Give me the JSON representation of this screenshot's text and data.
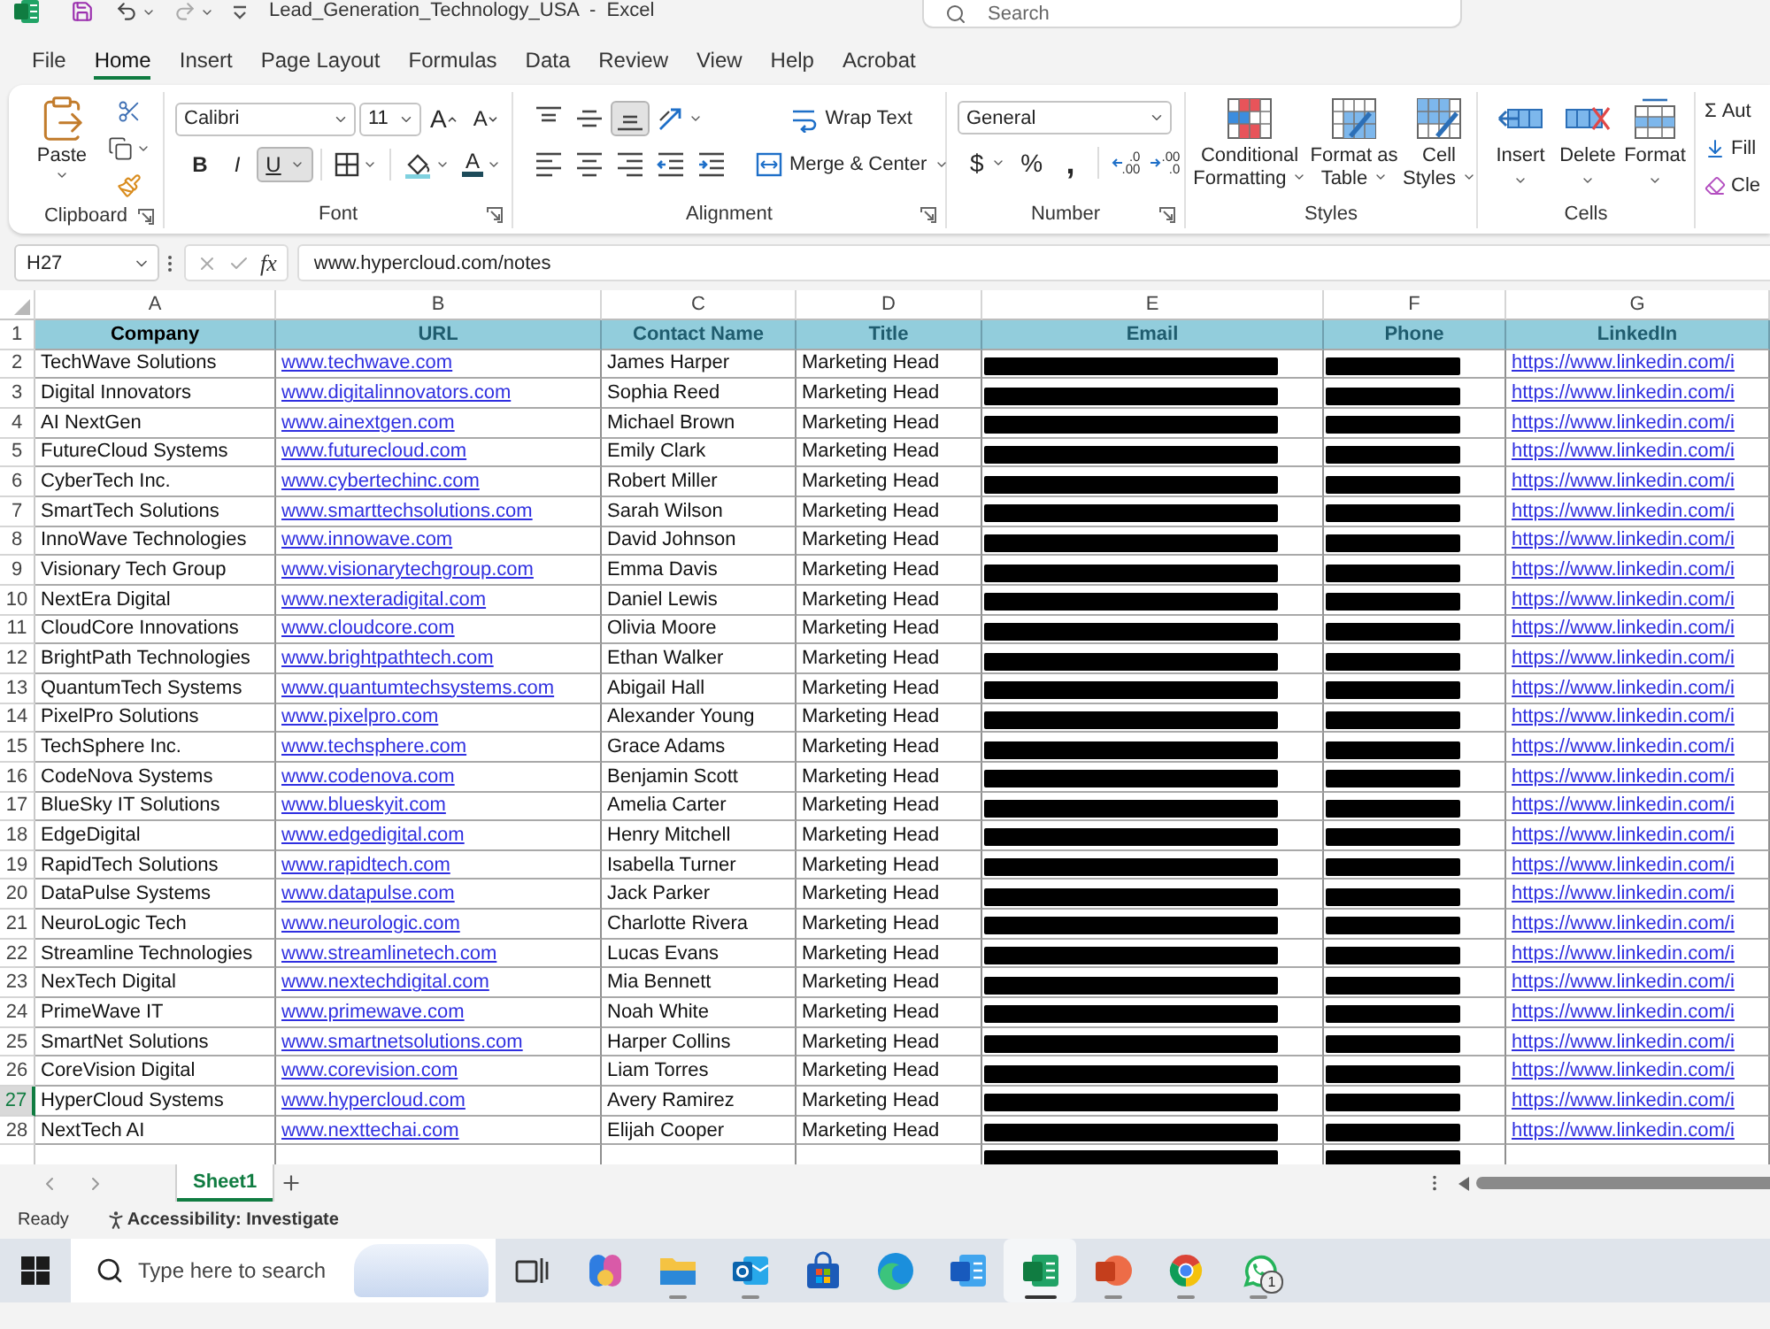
{
  "title_bar": {
    "title": "Lead_Generation_Technology_USA  -  Excel",
    "search_placeholder": "Search"
  },
  "menu_tabs": [
    {
      "label": "File",
      "selected": false
    },
    {
      "label": "Home",
      "selected": true
    },
    {
      "label": "Insert",
      "selected": false
    },
    {
      "label": "Page Layout",
      "selected": false
    },
    {
      "label": "Formulas",
      "selected": false
    },
    {
      "label": "Data",
      "selected": false
    },
    {
      "label": "Review",
      "selected": false
    },
    {
      "label": "View",
      "selected": false
    },
    {
      "label": "Help",
      "selected": false
    },
    {
      "label": "Acrobat",
      "selected": false
    }
  ],
  "ribbon": {
    "clipboard": {
      "label": "Clipboard",
      "paste": "Paste"
    },
    "font": {
      "label": "Font",
      "font_name": "Calibri",
      "font_size": "11",
      "grow_glyph": "A",
      "shrink_glyph": "A",
      "bold": {
        "glyph": "B",
        "selected": false
      },
      "italic": {
        "glyph": "I",
        "selected": false
      },
      "underline": {
        "glyph": "U",
        "selected": true
      },
      "font_color_glyph": "A"
    },
    "alignment": {
      "label": "Alignment",
      "vertical": [
        {
          "kind": "top",
          "selected": false
        },
        {
          "kind": "middle",
          "selected": false
        },
        {
          "kind": "bottom",
          "selected": true
        }
      ],
      "horizontal": [
        {
          "kind": "left",
          "selected": false
        },
        {
          "kind": "center",
          "selected": false
        },
        {
          "kind": "right",
          "selected": false
        }
      ],
      "wrap_text": "Wrap Text",
      "merge_center": "Merge & Center"
    },
    "number": {
      "label": "Number",
      "format": "General",
      "currency": "$",
      "percent": "%",
      "comma": ",",
      "decimals": [
        {
          "kind": "increase",
          "lines": [
            ".0",
            ".00"
          ]
        },
        {
          "kind": "decrease",
          "lines": [
            ".00",
            ".0"
          ]
        }
      ]
    },
    "styles": {
      "label": "Styles",
      "buttons": [
        {
          "kind": "conditional",
          "lines": [
            "Conditional",
            "Formatting"
          ]
        },
        {
          "kind": "table",
          "lines": [
            "Format as",
            "Table"
          ]
        },
        {
          "kind": "cell_styles",
          "lines": [
            "Cell",
            "Styles"
          ]
        }
      ]
    },
    "cells": {
      "label": "Cells",
      "buttons": [
        {
          "kind": "insert",
          "label": "Insert"
        },
        {
          "kind": "delete",
          "label": "Delete"
        },
        {
          "kind": "format",
          "label": "Format"
        }
      ]
    },
    "editing": {
      "items": [
        {
          "kind": "sum",
          "glyph": "Σ",
          "label": "Aut"
        },
        {
          "kind": "fill",
          "label": "Fill"
        },
        {
          "kind": "clear",
          "label": "Cle"
        }
      ]
    }
  },
  "formula_bar": {
    "name_box": "H27",
    "function_glyph": "fx",
    "formula": "www.hypercloud.com/notes"
  },
  "sheet": {
    "columns": [
      {
        "letter": "A",
        "heading": "Company",
        "kind": "text"
      },
      {
        "letter": "B",
        "heading": "URL",
        "kind": "link"
      },
      {
        "letter": "C",
        "heading": "Contact Name",
        "kind": "text"
      },
      {
        "letter": "D",
        "heading": "Title",
        "kind": "text"
      },
      {
        "letter": "E",
        "heading": "Email",
        "kind": "redacted"
      },
      {
        "letter": "F",
        "heading": "Phone",
        "kind": "redacted"
      },
      {
        "letter": "G",
        "heading": "LinkedIn",
        "kind": "link"
      }
    ],
    "header_row": "1",
    "rows": [
      {
        "number": "2",
        "cells": [
          "TechWave Solutions",
          "www.techwave.com",
          "James Harper",
          "Marketing Head",
          "https://www.linkedin.com/i"
        ],
        "selected": false
      },
      {
        "number": "3",
        "cells": [
          "Digital Innovators",
          "www.digitalinnovators.com",
          "Sophia Reed",
          "Marketing Head",
          "https://www.linkedin.com/i"
        ],
        "selected": false
      },
      {
        "number": "4",
        "cells": [
          "AI NextGen",
          "www.ainextgen.com",
          "Michael Brown",
          "Marketing Head",
          "https://www.linkedin.com/i"
        ],
        "selected": false
      },
      {
        "number": "5",
        "cells": [
          "FutureCloud Systems",
          "www.futurecloud.com",
          "Emily Clark",
          "Marketing Head",
          "https://www.linkedin.com/i"
        ],
        "selected": false
      },
      {
        "number": "6",
        "cells": [
          "CyberTech Inc.",
          "www.cybertechinc.com",
          "Robert Miller",
          "Marketing Head",
          "https://www.linkedin.com/i"
        ],
        "selected": false
      },
      {
        "number": "7",
        "cells": [
          "SmartTech Solutions",
          "www.smarttechsolutions.com",
          "Sarah Wilson",
          "Marketing Head",
          "https://www.linkedin.com/i"
        ],
        "selected": false
      },
      {
        "number": "8",
        "cells": [
          "InnoWave Technologies",
          "www.innowave.com",
          "David Johnson",
          "Marketing Head",
          "https://www.linkedin.com/i"
        ],
        "selected": false
      },
      {
        "number": "9",
        "cells": [
          "Visionary Tech Group",
          "www.visionarytechgroup.com",
          "Emma Davis",
          "Marketing Head",
          "https://www.linkedin.com/i"
        ],
        "selected": false
      },
      {
        "number": "10",
        "cells": [
          "NextEra Digital",
          "www.nexteradigital.com",
          "Daniel Lewis",
          "Marketing Head",
          "https://www.linkedin.com/i"
        ],
        "selected": false
      },
      {
        "number": "11",
        "cells": [
          "CloudCore Innovations",
          "www.cloudcore.com",
          "Olivia Moore",
          "Marketing Head",
          "https://www.linkedin.com/i"
        ],
        "selected": false
      },
      {
        "number": "12",
        "cells": [
          "BrightPath Technologies",
          "www.brightpathtech.com",
          "Ethan Walker",
          "Marketing Head",
          "https://www.linkedin.com/i"
        ],
        "selected": false
      },
      {
        "number": "13",
        "cells": [
          "QuantumTech Systems",
          "www.quantumtechsystems.com",
          "Abigail Hall",
          "Marketing Head",
          "https://www.linkedin.com/i"
        ],
        "selected": false
      },
      {
        "number": "14",
        "cells": [
          "PixelPro Solutions",
          "www.pixelpro.com",
          "Alexander Young",
          "Marketing Head",
          "https://www.linkedin.com/i"
        ],
        "selected": false
      },
      {
        "number": "15",
        "cells": [
          "TechSphere Inc.",
          "www.techsphere.com",
          "Grace Adams",
          "Marketing Head",
          "https://www.linkedin.com/i"
        ],
        "selected": false
      },
      {
        "number": "16",
        "cells": [
          "CodeNova Systems",
          "www.codenova.com",
          "Benjamin Scott",
          "Marketing Head",
          "https://www.linkedin.com/i"
        ],
        "selected": false
      },
      {
        "number": "17",
        "cells": [
          "BlueSky IT Solutions",
          "www.blueskyit.com",
          "Amelia Carter",
          "Marketing Head",
          "https://www.linkedin.com/i"
        ],
        "selected": false
      },
      {
        "number": "18",
        "cells": [
          "EdgeDigital",
          "www.edgedigital.com",
          "Henry Mitchell",
          "Marketing Head",
          "https://www.linkedin.com/i"
        ],
        "selected": false
      },
      {
        "number": "19",
        "cells": [
          "RapidTech Solutions",
          "www.rapidtech.com",
          "Isabella Turner",
          "Marketing Head",
          "https://www.linkedin.com/i"
        ],
        "selected": false
      },
      {
        "number": "20",
        "cells": [
          "DataPulse Systems",
          "www.datapulse.com",
          "Jack Parker",
          "Marketing Head",
          "https://www.linkedin.com/i"
        ],
        "selected": false
      },
      {
        "number": "21",
        "cells": [
          "NeuroLogic Tech",
          "www.neurologic.com",
          "Charlotte Rivera",
          "Marketing Head",
          "https://www.linkedin.com/i"
        ],
        "selected": false
      },
      {
        "number": "22",
        "cells": [
          "Streamline Technologies",
          "www.streamlinetech.com",
          "Lucas Evans",
          "Marketing Head",
          "https://www.linkedin.com/i"
        ],
        "selected": false
      },
      {
        "number": "23",
        "cells": [
          "NexTech Digital",
          "www.nextechdigital.com",
          "Mia Bennett",
          "Marketing Head",
          "https://www.linkedin.com/i"
        ],
        "selected": false
      },
      {
        "number": "24",
        "cells": [
          "PrimeWave IT",
          "www.primewave.com",
          "Noah White",
          "Marketing Head",
          "https://www.linkedin.com/i"
        ],
        "selected": false
      },
      {
        "number": "25",
        "cells": [
          "SmartNet Solutions",
          "www.smartnetsolutions.com",
          "Harper Collins",
          "Marketing Head",
          "https://www.linkedin.com/i"
        ],
        "selected": false
      },
      {
        "number": "26",
        "cells": [
          "CoreVision Digital",
          "www.corevision.com",
          "Liam Torres",
          "Marketing Head",
          "https://www.linkedin.com/i"
        ],
        "selected": false
      },
      {
        "number": "27",
        "cells": [
          "HyperCloud Systems",
          "www.hypercloud.com",
          "Avery Ramirez",
          "Marketing Head",
          "https://www.linkedin.com/i"
        ],
        "selected": true
      },
      {
        "number": "28",
        "cells": [
          "NextTech AI",
          "www.nexttechai.com",
          "Elijah Cooper",
          "Marketing Head",
          "https://www.linkedin.com/i"
        ],
        "selected": false
      }
    ]
  },
  "sheet_tabs": [
    {
      "label": "Sheet1",
      "selected": true
    }
  ],
  "status_bar": {
    "ready": "Ready",
    "accessibility": "Accessibility: Investigate"
  },
  "taskbar": {
    "search_placeholder": "Type here to search",
    "apps": [
      {
        "kind": "task_view",
        "running": false,
        "active": false
      },
      {
        "kind": "copilot",
        "running": false,
        "active": false
      },
      {
        "kind": "explorer",
        "running": true,
        "active": false
      },
      {
        "kind": "outlook",
        "running": true,
        "active": false
      },
      {
        "kind": "store",
        "running": false,
        "active": false
      },
      {
        "kind": "edge",
        "running": false,
        "active": false
      },
      {
        "kind": "word",
        "running": false,
        "active": false
      },
      {
        "kind": "excel",
        "running": true,
        "active": true
      },
      {
        "kind": "powerpoint",
        "running": true,
        "active": false
      },
      {
        "kind": "chrome",
        "running": true,
        "active": false
      },
      {
        "kind": "whatsapp",
        "running": true,
        "active": false,
        "badge": "1"
      }
    ]
  }
}
